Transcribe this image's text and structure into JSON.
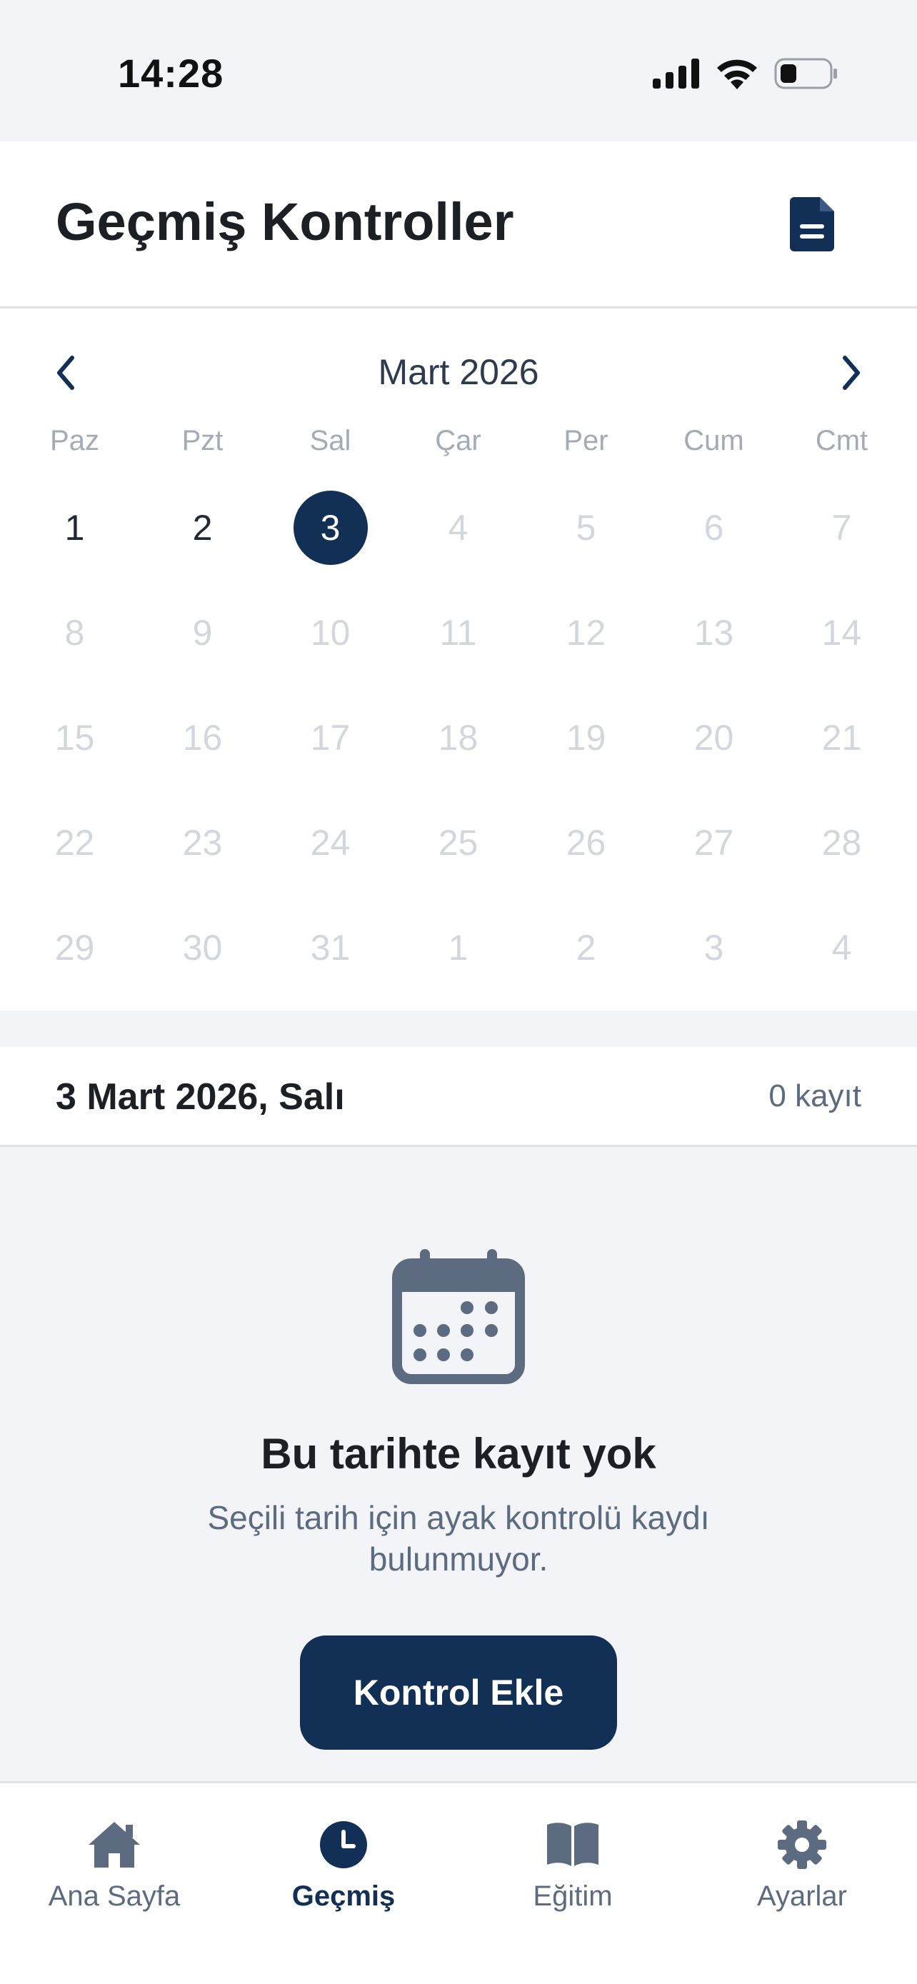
{
  "status_bar": {
    "time": "14:28",
    "battery_level": 0.25
  },
  "header": {
    "title": "Geçmiş Kontroller",
    "action_icon": "document-icon"
  },
  "calendar": {
    "month_label": "Mart 2026",
    "weekdays": [
      "Paz",
      "Pzt",
      "Sal",
      "Çar",
      "Per",
      "Cum",
      "Cmt"
    ],
    "days": [
      "1",
      "2",
      "3",
      "4",
      "5",
      "6",
      "7",
      "8",
      "9",
      "10",
      "11",
      "12",
      "13",
      "14",
      "15",
      "16",
      "17",
      "18",
      "19",
      "20",
      "21",
      "22",
      "23",
      "24",
      "25",
      "26",
      "27",
      "28",
      "29",
      "30",
      "31",
      "1",
      "2",
      "3",
      "4"
    ],
    "selected_day": "3",
    "active_days": [
      "1",
      "2",
      "3"
    ]
  },
  "selected_date": {
    "label": "3 Mart 2026, Salı",
    "count": "0 kayıt"
  },
  "empty_state": {
    "icon": "calendar-icon",
    "title": "Bu tarihte kayıt yok",
    "description": "Seçili tarih için ayak kontrolü kaydı bulunmuyor.",
    "button_label": "Kontrol Ekle"
  },
  "tabs": [
    {
      "label": "Ana Sayfa",
      "icon": "home-icon",
      "active": false
    },
    {
      "label": "Geçmiş",
      "icon": "clock-icon",
      "active": true
    },
    {
      "label": "Eğitim",
      "icon": "book-icon",
      "active": false
    },
    {
      "label": "Ayarlar",
      "icon": "gear-icon",
      "active": false
    }
  ],
  "colors": {
    "primary": "#122f55",
    "muted": "#5c6b80",
    "disabled": "#d3d7dd",
    "icon": "#5c6b80"
  }
}
